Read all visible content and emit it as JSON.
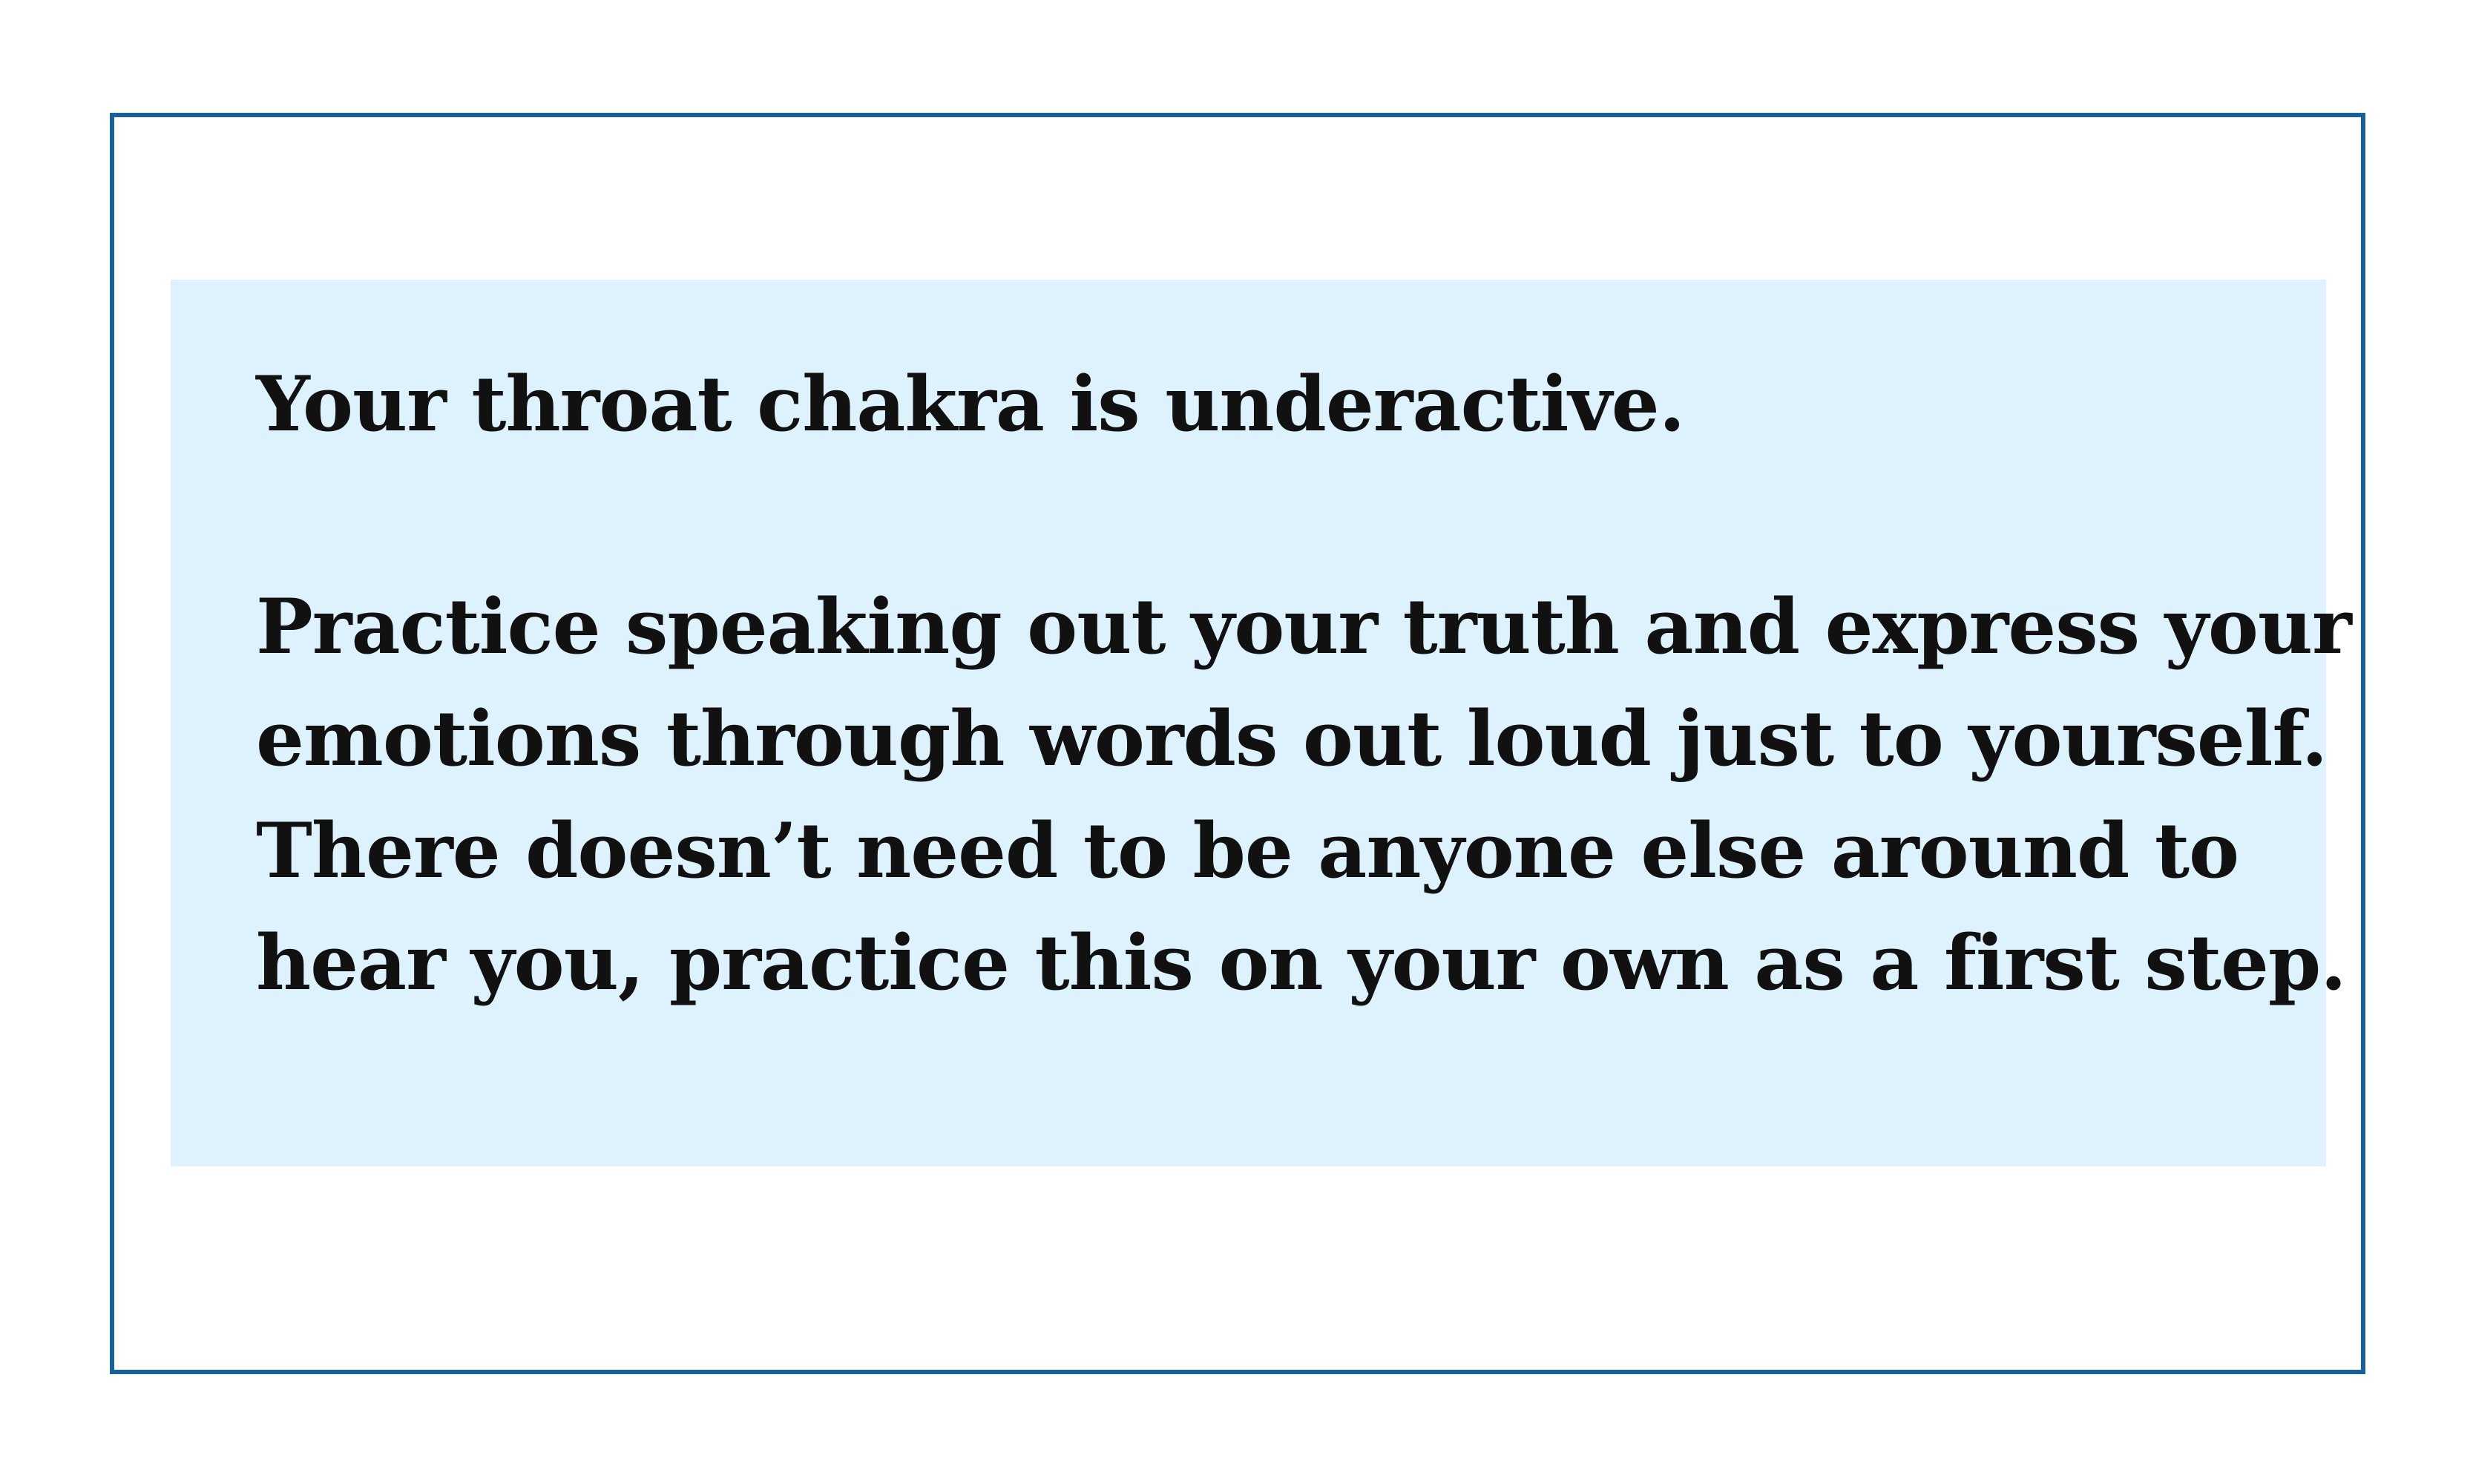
{
  "card": {
    "border_color": "#1b6096",
    "panel_color": "#ddf2fd",
    "headline": "Your throat chakra is underactive.",
    "body_lines": [
      "Practice speaking out your truth and express your",
      "emotions through words out loud just to yourself.",
      "There doesn’t need to be anyone else around to",
      "hear you, practice this on your own as a first step."
    ]
  }
}
